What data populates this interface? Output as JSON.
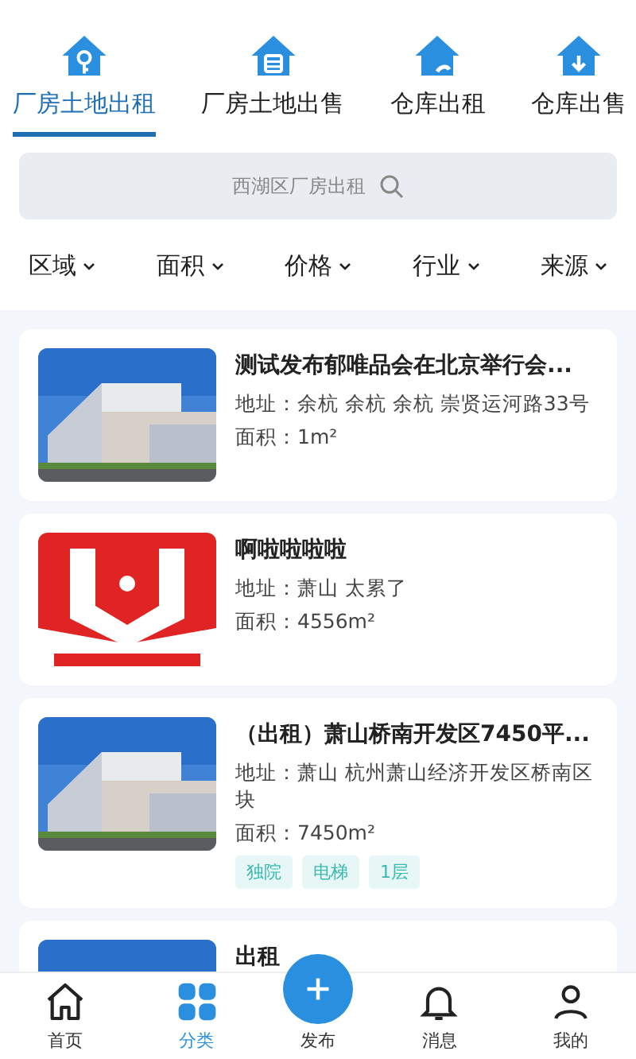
{
  "tabs": [
    {
      "label": "厂房土地出租",
      "selected": true
    },
    {
      "label": "厂房土地出售",
      "selected": false
    },
    {
      "label": "仓库出租",
      "selected": false
    },
    {
      "label": "仓库出售",
      "selected": false
    }
  ],
  "search": {
    "placeholder": "西湖区厂房出租"
  },
  "filters": [
    "区域",
    "面积",
    "价格",
    "行业",
    "来源"
  ],
  "listings": [
    {
      "kind": "building",
      "title": "测试发布郁唯品会在北京举行会...",
      "address": "地址：余杭 余杭 余杭 崇贤运河路33号",
      "area": "面积：1m²"
    },
    {
      "kind": "logo",
      "title": "啊啦啦啦啦",
      "address": "地址：萧山 太累了",
      "area": "面积：4556m²"
    },
    {
      "kind": "building",
      "title": "（出租）萧山桥南开发区7450平...",
      "address": "地址：萧山 杭州萧山经济开发区桥南区块",
      "area": "面积：7450m²",
      "tags": [
        "独院",
        "电梯",
        "1层"
      ]
    },
    {
      "kind": "building",
      "title": "出租"
    }
  ],
  "nav": [
    {
      "label": "首页",
      "kind": "home",
      "selected": false
    },
    {
      "label": "分类",
      "kind": "grid",
      "selected": true
    },
    {
      "label": "发布",
      "kind": "plus",
      "selected": false
    },
    {
      "label": "消息",
      "kind": "bell",
      "selected": false
    },
    {
      "label": "我的",
      "kind": "person",
      "selected": false
    }
  ]
}
